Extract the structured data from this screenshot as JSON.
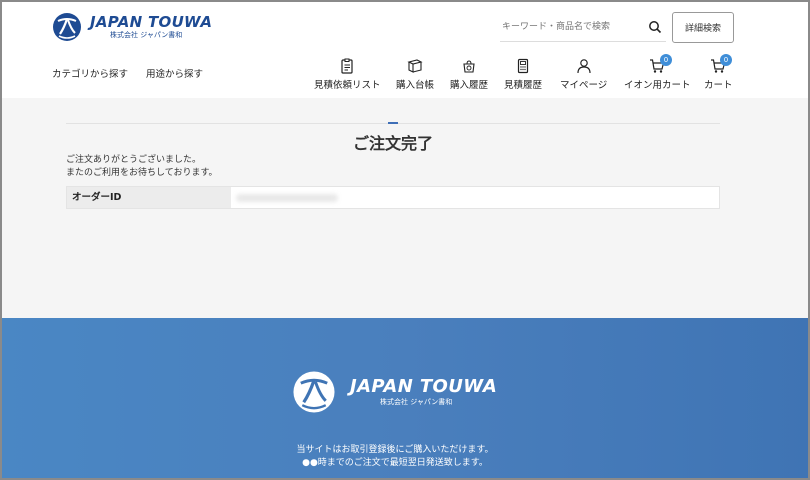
{
  "brand": {
    "name_en": "JAPAN TOUWA",
    "name_jp": "株式会社 ジャパン書和"
  },
  "header": {
    "search_placeholder": "キーワード・商品名で検索",
    "advanced_search_label": "詳細検索",
    "categories": [
      {
        "label": "カテゴリから探す"
      },
      {
        "label": "用途から探す"
      }
    ],
    "nav": [
      {
        "label": "見積依頼リスト",
        "icon": "clipboard-list-icon"
      },
      {
        "label": "購入台帳",
        "icon": "book-icon"
      },
      {
        "label": "購入履歴",
        "icon": "history-bag-icon"
      },
      {
        "label": "見積履歴",
        "icon": "calculator-icon"
      },
      {
        "label": "マイページ",
        "icon": "user-icon"
      },
      {
        "label": "イオン用カート",
        "icon": "cart-icon",
        "badge": "0"
      },
      {
        "label": "カート",
        "icon": "cart-icon",
        "badge": "0"
      }
    ]
  },
  "main": {
    "title": "ご注文完了",
    "message_line1": "ご注文ありがとうございました。",
    "message_line2": "またのご利用をお待ちしております。",
    "order_id_label": "オーダーID"
  },
  "footer": {
    "note_line1": "当サイトはお取引登録後にご購入いただけます。",
    "note_line2": "●●時までのご注文で最短翌日発送致します。"
  },
  "colors": {
    "brand_blue": "#1e4b93",
    "badge_blue": "#3f8ed8",
    "footer_blue": "#4a7fbd"
  }
}
